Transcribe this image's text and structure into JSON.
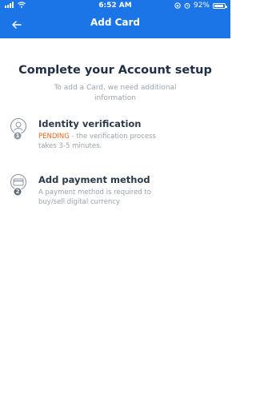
{
  "status_bar": {
    "time": "6:52 AM",
    "battery": "92%",
    "battery_level": 0.92
  },
  "header": {
    "title": "Add Card",
    "back_icon": "arrow-left-icon"
  },
  "main": {
    "title": "Complete your Account setup",
    "subtitle": "To add a Card, we need additional information",
    "steps": [
      {
        "number": "1",
        "icon": "identity-icon",
        "title": "Identity verification",
        "status": "PENDING",
        "description": " - the verification process takes 3-5 minutes."
      },
      {
        "number": "2",
        "icon": "credit-card-icon",
        "title": "Add payment method",
        "description": "A payment method is required to buy/sell digital currency"
      }
    ]
  },
  "colors": {
    "header_bg": "#1b75e6",
    "pending": "#e8641b",
    "title_text": "#1f2f46",
    "muted_text": "#9aa4ae"
  }
}
